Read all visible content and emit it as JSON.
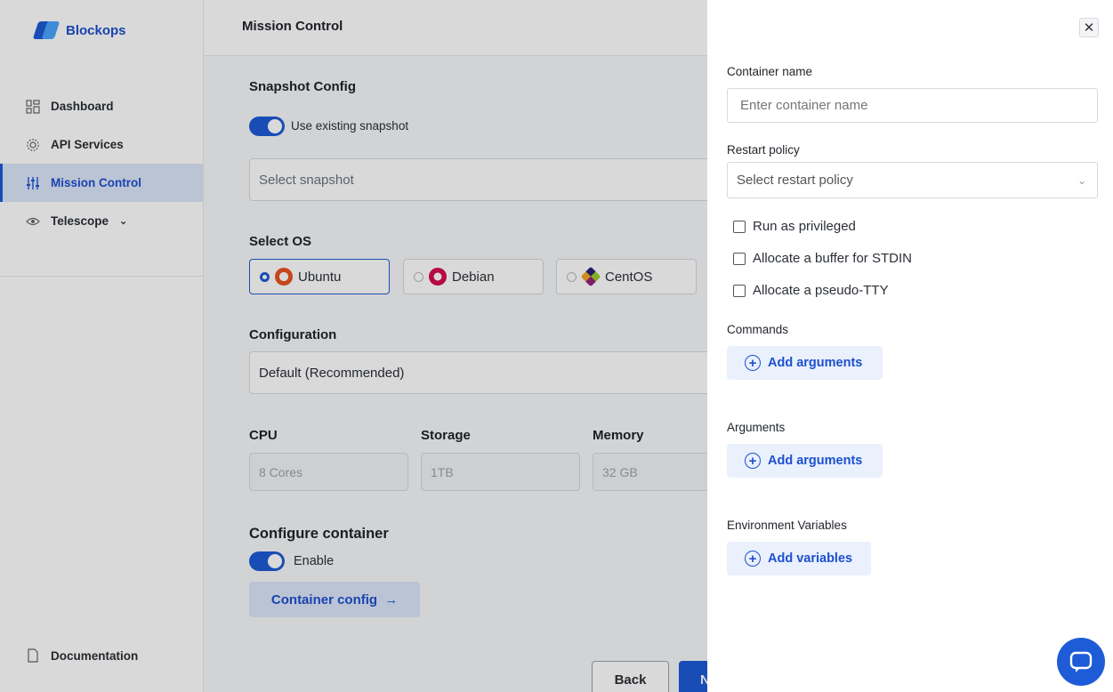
{
  "brand": {
    "name": "Blockops"
  },
  "sidebar": {
    "items": [
      {
        "label": "Dashboard",
        "icon": "dashboard-icon"
      },
      {
        "label": "API Services",
        "icon": "gear-icon"
      },
      {
        "label": "Mission Control",
        "icon": "sliders-icon",
        "active": true
      },
      {
        "label": "Telescope",
        "icon": "eye-icon",
        "expandable": true
      }
    ],
    "footer": {
      "label": "Documentation",
      "icon": "document-icon"
    }
  },
  "header": {
    "title": "Mission Control"
  },
  "main": {
    "snapshot": {
      "title": "Snapshot Config",
      "toggle_label": "Use existing snapshot",
      "select_placeholder": "Select snapshot"
    },
    "os": {
      "title": "Select OS",
      "options": [
        {
          "label": "Ubuntu",
          "selected": true
        },
        {
          "label": "Debian",
          "selected": false
        },
        {
          "label": "CentOS",
          "selected": false
        }
      ]
    },
    "configuration": {
      "title": "Configuration",
      "value": "Default (Recommended)"
    },
    "resources": {
      "cpu": {
        "label": "CPU",
        "value": "8 Cores"
      },
      "storage": {
        "label": "Storage",
        "value": "1TB"
      },
      "memory": {
        "label": "Memory",
        "value": "32 GB"
      }
    },
    "container": {
      "title": "Configure container",
      "toggle_label": "Enable",
      "config_button": "Container config"
    },
    "footer_buttons": {
      "back": "Back",
      "next": "N"
    }
  },
  "drawer": {
    "container_name": {
      "label": "Container name",
      "placeholder": "Enter container name"
    },
    "restart_policy": {
      "label": "Restart policy",
      "placeholder": "Select restart policy"
    },
    "checkboxes": [
      "Run as privileged",
      "Allocate a buffer for STDIN",
      "Allocate a pseudo-TTY"
    ],
    "commands": {
      "label": "Commands",
      "button": "Add arguments"
    },
    "arguments": {
      "label": "Arguments",
      "button": "Add arguments"
    },
    "env": {
      "label": "Environment Variables",
      "button": "Add variables"
    }
  },
  "colors": {
    "accent": "#1e5bd6",
    "accent_light": "#dce7f9"
  }
}
